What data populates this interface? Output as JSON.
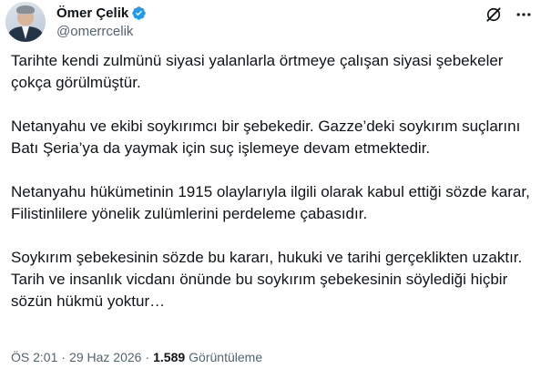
{
  "author": {
    "display_name": "Ömer Çelik",
    "handle": "@omerrcelik",
    "verified": true
  },
  "tweet": {
    "paragraphs": [
      "Tarihte kendi zulmünü siyasi yalanlarla örtmeye çalışan siyasi şebekeler çokça görülmüştür.",
      "Netanyahu ve ekibi soykırımcı bir şebekedir. Gazze’deki soykırım suçlarını Batı Şeria’ya da yaymak için suç işlemeye devam etmektedir.",
      "Netanyahu hükümetinin 1915 olaylarıyla ilgili olarak kabul ettiği sözde karar, Filistinlilere yönelik zulümlerini perdeleme çabasıdır.",
      "Soykırım şebekesinin sözde bu kararı, hukuki ve tarihi gerçeklikten uzaktır.",
      "Tarih ve insanlık vicdanı önünde bu soykırım şebekesinin söylediği hiçbir sözün hükmü yoktur…"
    ]
  },
  "meta": {
    "time": "ÖS 2:01",
    "separator": "·",
    "date": "29 Haz 2026",
    "views_count": "1.589",
    "views_label": "Görüntüleme"
  },
  "icons": {
    "verified": "verified-badge-icon",
    "grok": "grok-icon",
    "more": "more-options-icon"
  },
  "colors": {
    "text": "#0f1419",
    "secondary": "#536471",
    "verified_blue": "#1d9bf0"
  }
}
